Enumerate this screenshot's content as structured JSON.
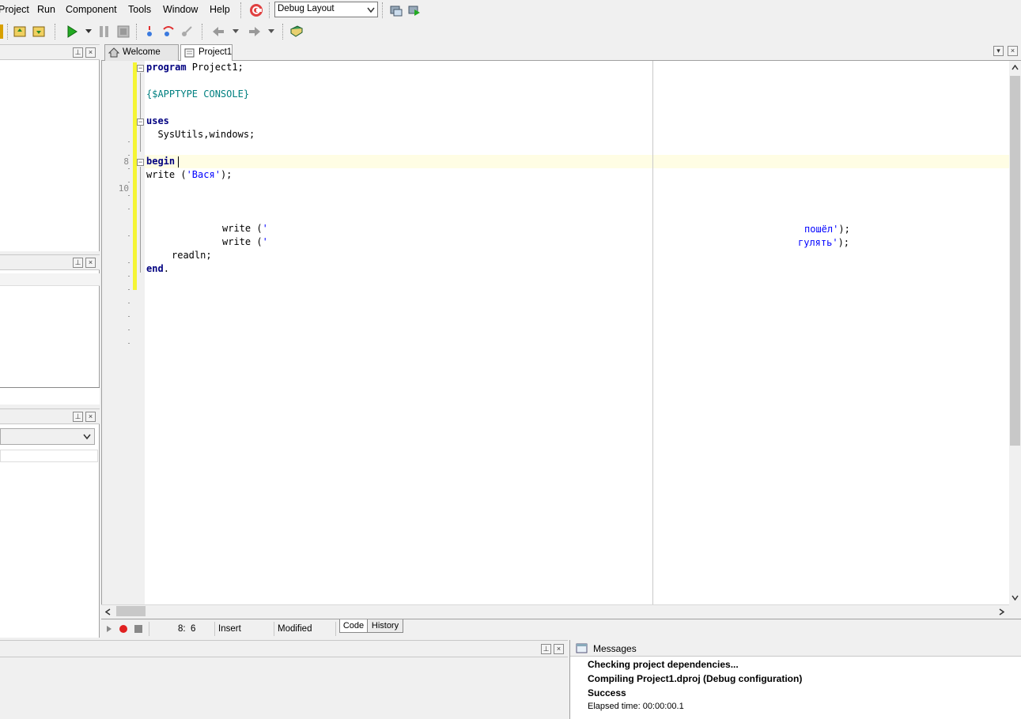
{
  "menu": {
    "items": [
      "Project",
      "Run",
      "Component",
      "Tools",
      "Window",
      "Help"
    ],
    "layout_select": "Debug Layout"
  },
  "toolbar": {
    "icons": [
      "open-project-icon",
      "save-icon",
      "save-all-icon",
      "run-icon",
      "run-dropdown-icon",
      "pause-icon",
      "stop-icon",
      "trace-into-icon",
      "step-over-icon",
      "run-to-cursor-icon",
      "back-icon",
      "back-dropdown-icon",
      "forward-icon",
      "forward-dropdown-icon",
      "help-book-icon"
    ]
  },
  "tabs": [
    {
      "label": "Welcome Page",
      "icon": "home-icon",
      "active": false
    },
    {
      "label": "Project1",
      "icon": "project-icon",
      "active": true
    }
  ],
  "gutter": {
    "line_numbers": [
      "8",
      "10"
    ]
  },
  "code": {
    "lines": [
      {
        "parts": [
          {
            "t": "program",
            "c": "kw"
          },
          {
            "t": " Project1;",
            "c": ""
          }
        ]
      },
      {
        "parts": [
          {
            "t": "{$APPTYPE CONSOLE}",
            "c": "dir"
          }
        ]
      },
      {
        "parts": [
          {
            "t": "uses",
            "c": "kw"
          }
        ]
      },
      {
        "parts": [
          {
            "t": "  SysUtils,windows;",
            "c": ""
          }
        ]
      },
      {
        "parts": [
          {
            "t": "begin",
            "c": "kw"
          }
        ]
      },
      {
        "parts": [
          {
            "t": "write (",
            "c": ""
          },
          {
            "t": "'Вася'",
            "c": "str"
          },
          {
            "t": ");",
            "c": ""
          }
        ]
      },
      {
        "parts": [
          {
            "t": "write (",
            "c": ""
          },
          {
            "t": "'",
            "c": "str"
          }
        ]
      },
      {
        "parts": [
          {
            "t": "write (",
            "c": ""
          },
          {
            "t": "'",
            "c": "str"
          }
        ]
      },
      {
        "parts": [
          {
            "t": "readln;",
            "c": ""
          }
        ]
      },
      {
        "parts": [
          {
            "t": "end",
            "c": "kw"
          },
          {
            "t": ".",
            "c": ""
          }
        ]
      }
    ],
    "tail1": {
      "str": "пошёл'",
      "rest": ");"
    },
    "tail2": {
      "str": "гулять'",
      "rest": ");"
    }
  },
  "status": {
    "position": "8:  6",
    "mode": "Insert",
    "state": "Modified",
    "code_tab": "Code",
    "history_tab": "History"
  },
  "messages": {
    "title": "Messages",
    "lines": [
      {
        "text": "Checking project dependencies...",
        "bold": true
      },
      {
        "text": "Compiling Project1.dproj (Debug configuration)",
        "bold": true
      },
      {
        "text": "Success",
        "bold": true
      },
      {
        "text": "Elapsed time: 00:00:00.1",
        "bold": false
      }
    ]
  },
  "colors": {
    "keyword": "#000080",
    "directive": "#008080",
    "string": "#0000ff",
    "modified_bar": "#f5f534",
    "current_line": "#fffde4"
  }
}
